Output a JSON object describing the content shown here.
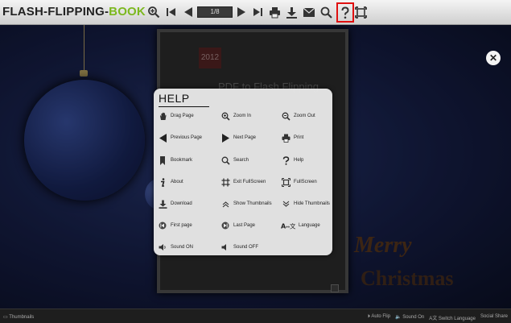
{
  "logo": {
    "part1": "FLASH-FLIPPING-",
    "part2": "BOOK"
  },
  "toolbar": {
    "page_indicator": "1/8",
    "icons": [
      "zoom-in-icon",
      "first-page-icon",
      "previous-page-icon",
      "page-indicator",
      "next-page-icon",
      "last-page-icon",
      "print-icon",
      "download-icon",
      "email-icon",
      "search-icon",
      "help-icon",
      "fullscreen-icon"
    ]
  },
  "book": {
    "year": "2012",
    "title": "PDF to Flash Flipping"
  },
  "greeting": {
    "line1": "Merry",
    "line2": "Christmas"
  },
  "help": {
    "title": "HELP",
    "rows": [
      [
        {
          "icon": "hand-icon",
          "label": "Drag Page"
        },
        {
          "icon": "zoom-in-icon",
          "label": "Zoom In"
        },
        {
          "icon": "zoom-out-icon",
          "label": "Zoom Out"
        }
      ],
      [
        {
          "icon": "previous-page-icon",
          "label": "Previous Page"
        },
        {
          "icon": "next-page-icon",
          "label": "Next Page"
        },
        {
          "icon": "print-icon",
          "label": "Print"
        }
      ],
      [
        {
          "icon": "bookmark-icon",
          "label": "Bookmark"
        },
        {
          "icon": "search-icon",
          "label": "Search"
        },
        {
          "icon": "help-icon",
          "label": "Help"
        }
      ],
      [
        {
          "icon": "about-icon",
          "label": "About"
        },
        {
          "icon": "exit-fullscreen-icon",
          "label": "Exit FullScreen"
        },
        {
          "icon": "fullscreen-icon",
          "label": "FullScreen"
        }
      ],
      [
        {
          "icon": "download-icon",
          "label": "Download"
        },
        {
          "icon": "show-thumbnails-icon",
          "label": "Show Thumbnails"
        },
        {
          "icon": "hide-thumbnails-icon",
          "label": "Hide Thumbnails"
        }
      ],
      [
        {
          "icon": "first-page-icon",
          "label": "First page"
        },
        {
          "icon": "last-page-icon",
          "label": "Last Page"
        },
        {
          "icon": "language-icon",
          "label": "Language"
        }
      ],
      [
        {
          "icon": "sound-on-icon",
          "label": "Sound ON"
        },
        {
          "icon": "sound-off-icon",
          "label": "Sound OFF"
        }
      ]
    ]
  },
  "bottom": {
    "left": "Thumbnails",
    "right": [
      "Auto Flip",
      "Sound On",
      "Switch Language",
      "Social Share"
    ]
  }
}
